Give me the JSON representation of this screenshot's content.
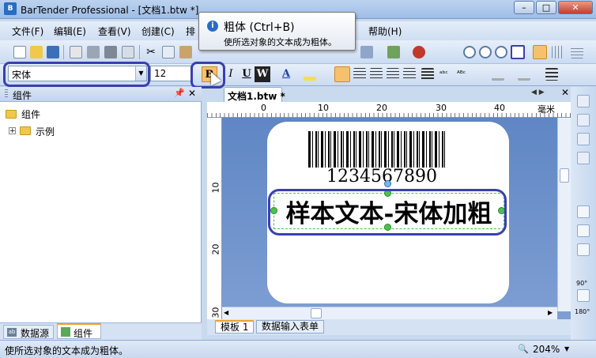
{
  "window": {
    "title": "BarTender Professional - [文档1.btw *]"
  },
  "menu": [
    "文件(F)",
    "编辑(E)",
    "查看(V)",
    "创建(C)",
    "排",
    "帮助(H)"
  ],
  "font_toolbar": {
    "font_name": "宋体",
    "font_size": "12",
    "bold_label": "B",
    "italic_label": "I",
    "underline_label": "U",
    "wordart_label": "W",
    "font_color_label": "A"
  },
  "tooltip": {
    "title": "粗体 (Ctrl+B)",
    "description": "使所选对象的文本成为粗体。"
  },
  "left_panel": {
    "title": "组件",
    "tree_root": "组件",
    "tree_child": "示例",
    "tabs": [
      "数据源",
      "组件"
    ]
  },
  "document": {
    "tab_title": "文档1.btw *",
    "ruler_unit": "毫米",
    "h_ruler_ticks": [
      "0",
      "10",
      "20",
      "30",
      "40"
    ],
    "v_ruler_ticks": [
      "10",
      "20",
      "30"
    ],
    "barcode_text": "1234567890",
    "sample_text": "样本文本-宋体加粗"
  },
  "bottom_tabs": [
    "模板 1",
    "数据输入表单"
  ],
  "right_toolbar": {
    "rotate_90": "90°",
    "rotate_180": "180°"
  },
  "status": {
    "text": "使所选对象的文本成为粗体。",
    "zoom": "204%"
  },
  "colors": {
    "ring": "#3a3fb0",
    "selection_handle": "#4cc24c",
    "canvas_bg": "#6a8fca"
  }
}
